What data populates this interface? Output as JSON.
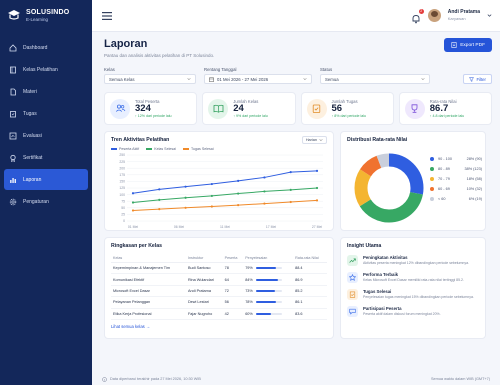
{
  "app": {
    "name": "SOLUSINDO",
    "subtitle": "E-Learning"
  },
  "sidebar": {
    "items": [
      {
        "label": "Dashboard",
        "icon": "home-icon"
      },
      {
        "label": "Kelas Pelatihan",
        "icon": "book-icon"
      },
      {
        "label": "Materi",
        "icon": "file-icon"
      },
      {
        "label": "Tugas",
        "icon": "clipboard-icon"
      },
      {
        "label": "Evaluasi",
        "icon": "chart-check-icon"
      },
      {
        "label": "Sertifikat",
        "icon": "certificate-icon"
      },
      {
        "label": "Laporan",
        "icon": "bar-chart-icon",
        "active": true
      },
      {
        "label": "Pengaturan",
        "icon": "gear-icon"
      }
    ]
  },
  "topbar": {
    "notifications": "2",
    "user_name": "Andi Pratama",
    "user_role": "Karyawan"
  },
  "page": {
    "title": "Laporan",
    "subtitle": "Pantau dan analisis aktivitas pelatihan di PT Solusindo.",
    "export_label": "Export PDF"
  },
  "filters": {
    "kelas_label": "Kelas",
    "kelas_value": "Semua Kelas",
    "tanggal_label": "Rentang Tanggal",
    "tanggal_value": "01 Mei 2026 - 27 Mei 2026",
    "status_label": "Status",
    "status_value": "Semua",
    "filter_button": "Filter"
  },
  "stats": [
    {
      "label": "Total Peserta",
      "value": "324",
      "delta": "↑ 12% dari periode lalu",
      "color": "#3b6ee8",
      "bg": "#e8efff",
      "icon": "users-icon"
    },
    {
      "label": "Jumlah Kelas",
      "value": "24",
      "delta": "↑ 9% dari periode lalu",
      "color": "#2e9e5b",
      "bg": "#e3f5ea",
      "icon": "open-book-icon"
    },
    {
      "label": "Jumlah Tugas",
      "value": "56",
      "delta": "↑ 8% dari periode lalu",
      "color": "#e08a24",
      "bg": "#fdf0df",
      "icon": "task-icon"
    },
    {
      "label": "Rata-rata Nilai",
      "value": "86.7",
      "delta": "↑ 4.8 dari periode lalu",
      "color": "#7a4ed8",
      "bg": "#efe8fd",
      "icon": "trophy-icon"
    }
  ],
  "trend": {
    "title": "Tren Aktivitas Pelatihan",
    "period": "Harian"
  },
  "chart_data": {
    "type": "line",
    "title": "Tren Aktivitas Pelatihan",
    "x": [
      "01 Mei",
      "05 Mei",
      "09 Mei",
      "13 Mei",
      "17 Mei",
      "21 Mei",
      "25 Mei",
      "27 Mei"
    ],
    "tick_labels": [
      "01 Mei",
      "06 Mei",
      "11 Mei",
      "17 Mei",
      "27 Mei"
    ],
    "ylim": [
      0,
      250
    ],
    "yticks": [
      0,
      25,
      50,
      75,
      100,
      125,
      150,
      175,
      200,
      225,
      250
    ],
    "legend_position": "top-left",
    "grid": true,
    "series": [
      {
        "name": "Peserta Aktif",
        "color": "#2f5ee0",
        "values": [
          105,
          120,
          130,
          140,
          152,
          165,
          185,
          190
        ]
      },
      {
        "name": "Kelas Selesai",
        "color": "#37a864",
        "values": [
          70,
          80,
          88,
          95,
          104,
          112,
          118,
          125
        ]
      },
      {
        "name": "Tugas Selesai",
        "color": "#f08a2a",
        "values": [
          40,
          45,
          50,
          55,
          60,
          66,
          72,
          78
        ]
      }
    ]
  },
  "donut": {
    "title": "Distribusi Rata-rata Nilai",
    "chart": {
      "type": "pie",
      "categories": [
        "90 - 100",
        "80 - 89",
        "70 - 79",
        "60 - 69",
        "< 60"
      ],
      "values": [
        28,
        38,
        18,
        10,
        6
      ],
      "colors": [
        "#2f5ee0",
        "#37a864",
        "#f4b531",
        "#f0722f",
        "#c9cfdc"
      ],
      "labels": [
        "28% (90)",
        "38% (123)",
        "18% (58)",
        "10% (32)",
        "6% (19)"
      ]
    }
  },
  "ringkasan": {
    "title": "Ringkasan per Kelas",
    "columns": [
      "Kelas",
      "Instruktur",
      "Peserta",
      "Penyelesaian",
      "Rata-rata Nilai"
    ],
    "rows": [
      {
        "kelas": "Kepemimpinan & Manajemen Tim",
        "instruktur": "Budi Santoso",
        "peserta": "78",
        "pct": "79%",
        "frac": 0.79,
        "nilai": "88.4"
      },
      {
        "kelas": "Komunikasi Efektif",
        "instruktur": "Rina Wulandari",
        "peserta": "64",
        "pct": "84%",
        "frac": 0.84,
        "nilai": "86.9"
      },
      {
        "kelas": "Microsoft Excel Dasar",
        "instruktur": "Andi Pratama",
        "peserta": "72",
        "pct": "73%",
        "frac": 0.73,
        "nilai": "85.2"
      },
      {
        "kelas": "Pelayanan Pelanggan",
        "instruktur": "Dewi Lestari",
        "peserta": "56",
        "pct": "78%",
        "frac": 0.78,
        "nilai": "86.1"
      },
      {
        "kelas": "Etika Kerja Profesional",
        "instruktur": "Fajar Nugroho",
        "peserta": "42",
        "pct": "60%",
        "frac": 0.6,
        "nilai": "83.6"
      }
    ],
    "link": "Lihat semua kelas →"
  },
  "insight": {
    "title": "Insight Utama",
    "items": [
      {
        "title": "Peningkatan Aktivitas",
        "desc": "Aktivitas peserta meningkat 12% dibandingkan periode sebelumnya.",
        "color": "#2e9e5b",
        "bg": "#e3f5ea",
        "icon": "trend-up-icon"
      },
      {
        "title": "Performa Terbaik",
        "desc": "Kelas Microsoft Excel Dasar memiliki rata-rata nilai tertinggi 85.2.",
        "color": "#3b6ee8",
        "bg": "#e8efff",
        "icon": "star-icon"
      },
      {
        "title": "Tugas Selesai",
        "desc": "Penyelesaian tugas meningkat 15% dibandingkan periode sebelumnya.",
        "color": "#e08a24",
        "bg": "#fdf0df",
        "icon": "task-icon"
      },
      {
        "title": "Partisipasi Peserta",
        "desc": "Peserta aktif dalam diskusi forum meningkat 20%.",
        "color": "#3b6ee8",
        "bg": "#e8efff",
        "icon": "chat-icon"
      }
    ]
  },
  "footer": {
    "updated": "Data diperbarui terakhir pada 27 Mei 2026, 10:30 WIB",
    "timezone": "Semua waktu dalam WIB (GMT+7)"
  }
}
